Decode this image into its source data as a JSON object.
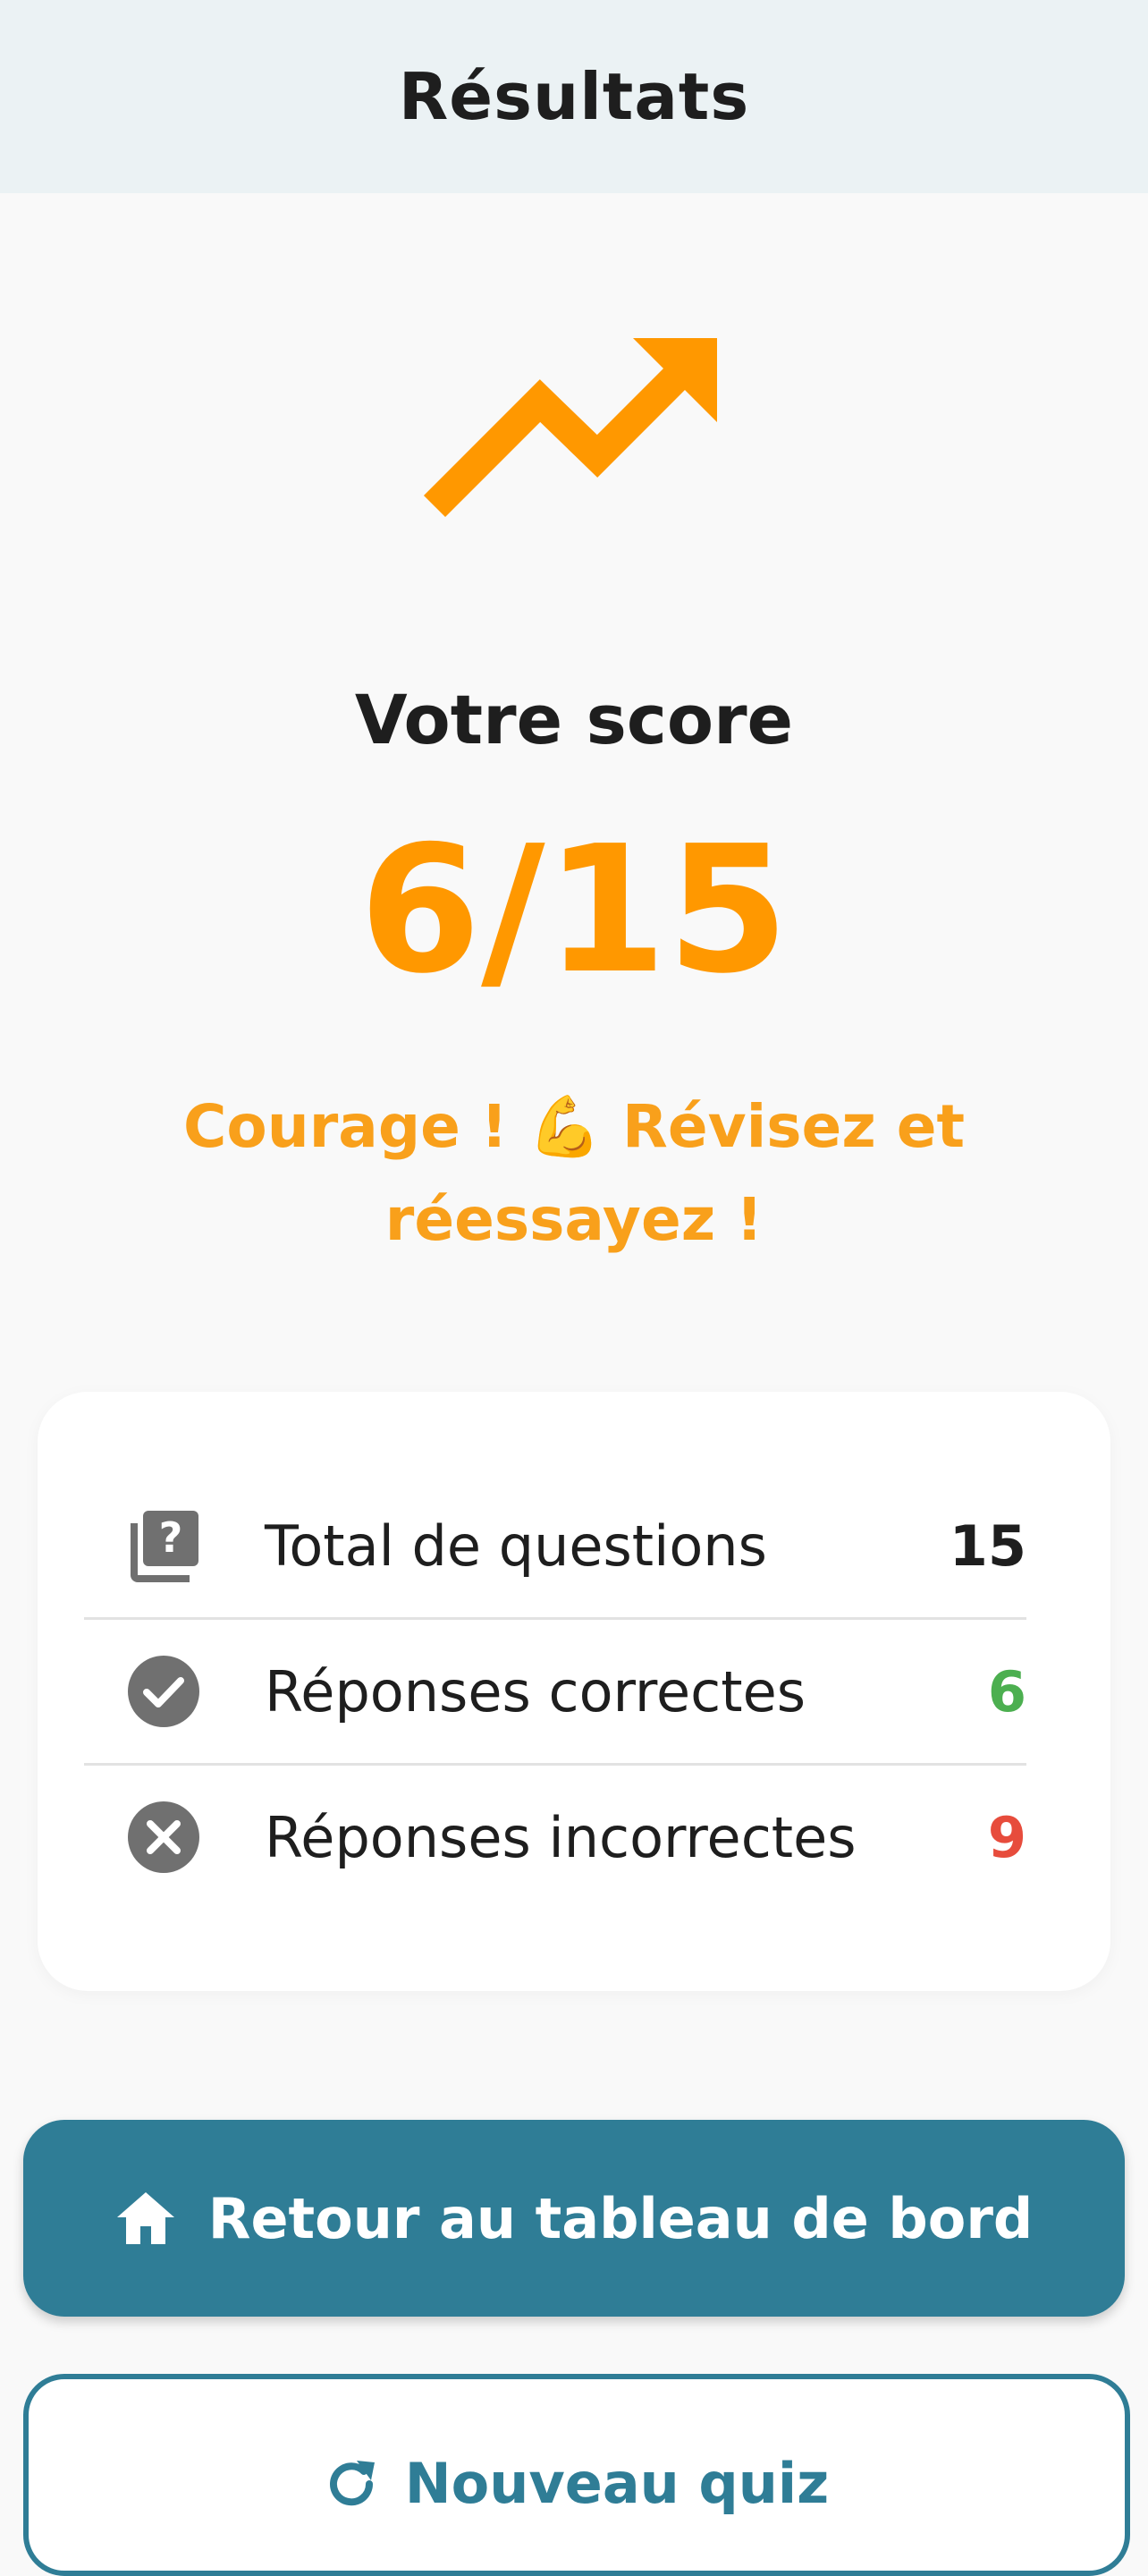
{
  "header": {
    "title": "Résultats"
  },
  "hero": {
    "icon": "trending-up-icon",
    "score_label": "Votre score",
    "score_value": "6/15",
    "message": "Courage ! 💪 Révisez et réessayez !"
  },
  "stats": {
    "rows": [
      {
        "icon": "question-library-icon",
        "label": "Total de questions",
        "value": "15",
        "color": "#1e1e1e"
      },
      {
        "icon": "check-circle-icon",
        "label": "Réponses correctes",
        "value": "6",
        "color": "#4caf50"
      },
      {
        "icon": "cancel-circle-icon",
        "label": "Réponses incorrectes",
        "value": "9",
        "color": "#e74c3c"
      }
    ]
  },
  "actions": {
    "dashboard_label": "Retour au tableau de bord",
    "new_quiz_label": "Nouveau quiz"
  },
  "colors": {
    "accent": "#ff9800",
    "primary": "#2f7d96",
    "header_bg": "#ebf2f4"
  }
}
